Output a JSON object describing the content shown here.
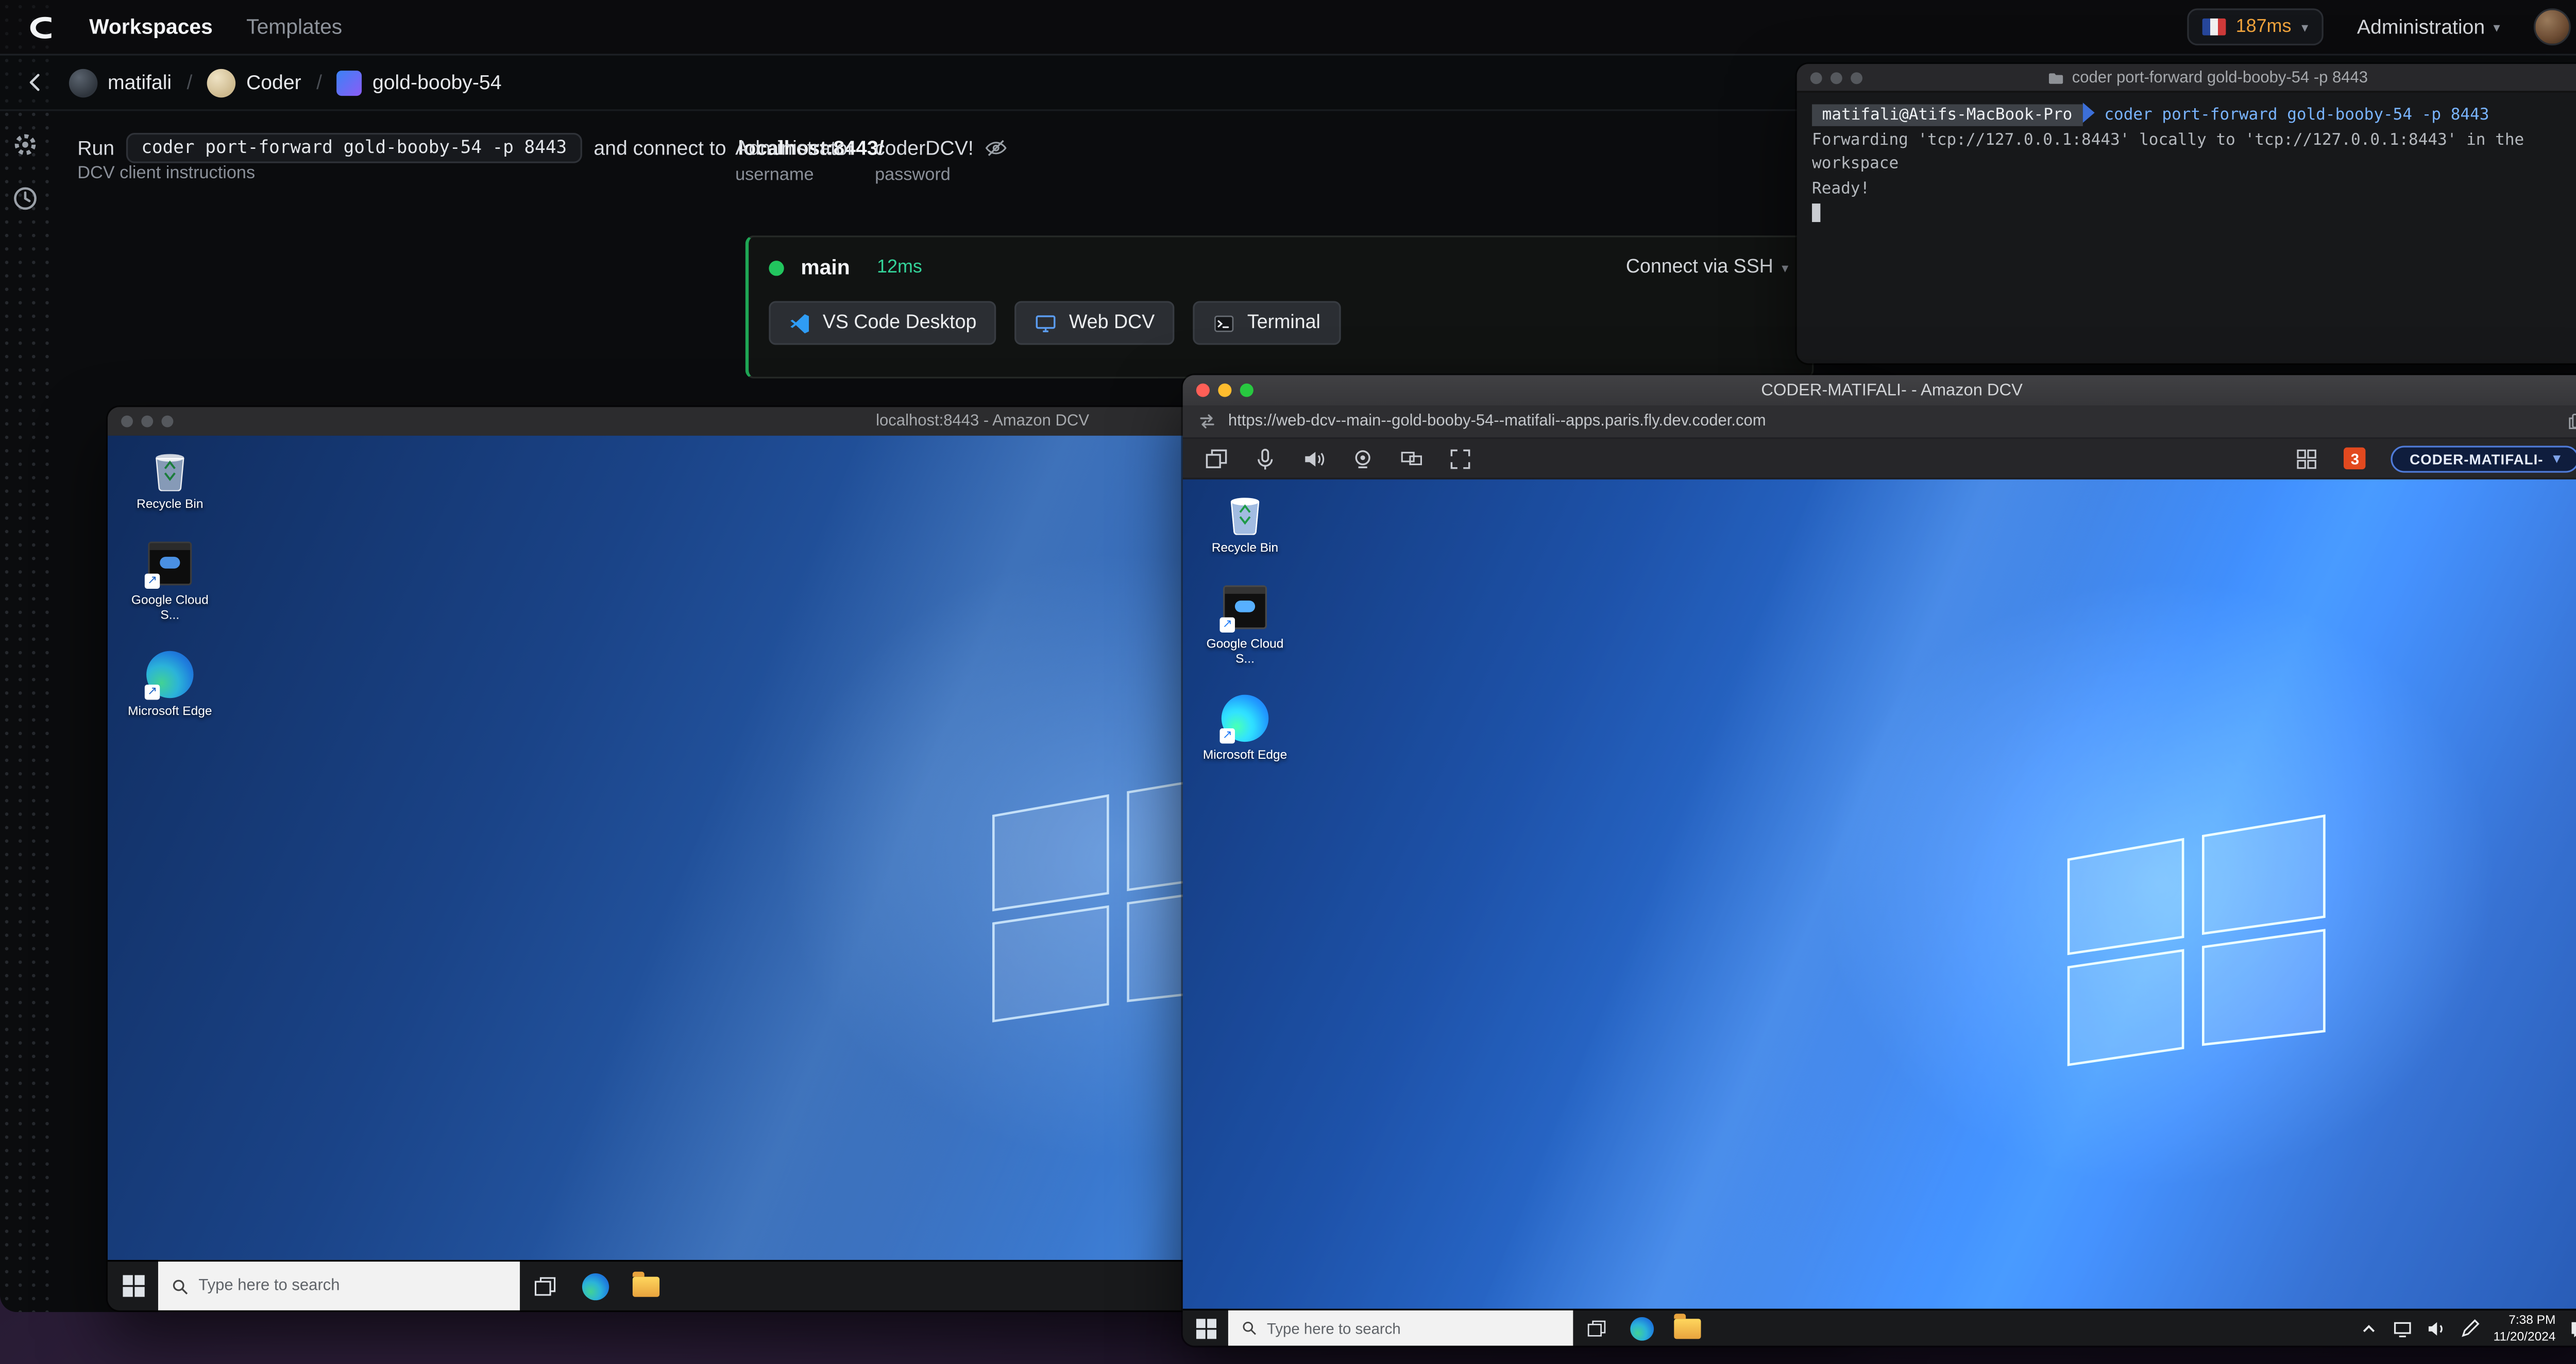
{
  "app": {
    "nav": {
      "workspaces": "Workspaces",
      "templates": "Templates",
      "latency": "187ms",
      "administration": "Administration"
    },
    "breadcrumb": {
      "user": "matifali",
      "template": "Coder",
      "workspace": "gold-booby-54"
    },
    "instructions": {
      "run": "Run",
      "command": "coder port-forward gold-booby-54 -p 8443",
      "connect": "and connect to",
      "target": "localhost:8443/",
      "dcv_link": "DCV client instructions",
      "username_value": "Administrator",
      "username_label": "username",
      "password_value": "coderDCV!",
      "password_label": "password"
    },
    "agent": {
      "name": "main",
      "latency": "12ms",
      "ssh": "Connect via SSH",
      "buttons": [
        {
          "label": "VS Code Desktop"
        },
        {
          "label": "Web DCV"
        },
        {
          "label": "Terminal"
        }
      ]
    }
  },
  "terminal_window": {
    "title": "coder port-forward gold-booby-54 -p 8443",
    "prompt_host": "matifali@Atifs-MacBook-Pro",
    "command": "coder port-forward gold-booby-54 -p 8443",
    "line_forwarding": "Forwarding 'tcp://127.0.0.1:8443' locally to 'tcp://127.0.0.1:8443' in the workspace",
    "line_ready": "Ready!"
  },
  "left_window": {
    "title": "localhost:8443 - Amazon DCV"
  },
  "right_window": {
    "title": "CODER-MATIFALI- - Amazon DCV",
    "url": "https://web-dcv--main--gold-booby-54--matifali--apps.paris.fly.dev.coder.com",
    "notification_count": "3",
    "session_name": "CODER-MATIFALI-"
  },
  "desktop": {
    "icons": [
      {
        "label": "Recycle Bin"
      },
      {
        "label": "Google Cloud S..."
      },
      {
        "label": "Microsoft Edge"
      }
    ],
    "search_placeholder": "Type here to search",
    "clock_time": "7:38 PM",
    "clock_date": "11/20/2024"
  },
  "colors": {
    "accent_green": "#22c55e",
    "latency_orange": "#f0a33c",
    "badge_red": "#e2491f",
    "session_blue": "#4f7bd9"
  }
}
